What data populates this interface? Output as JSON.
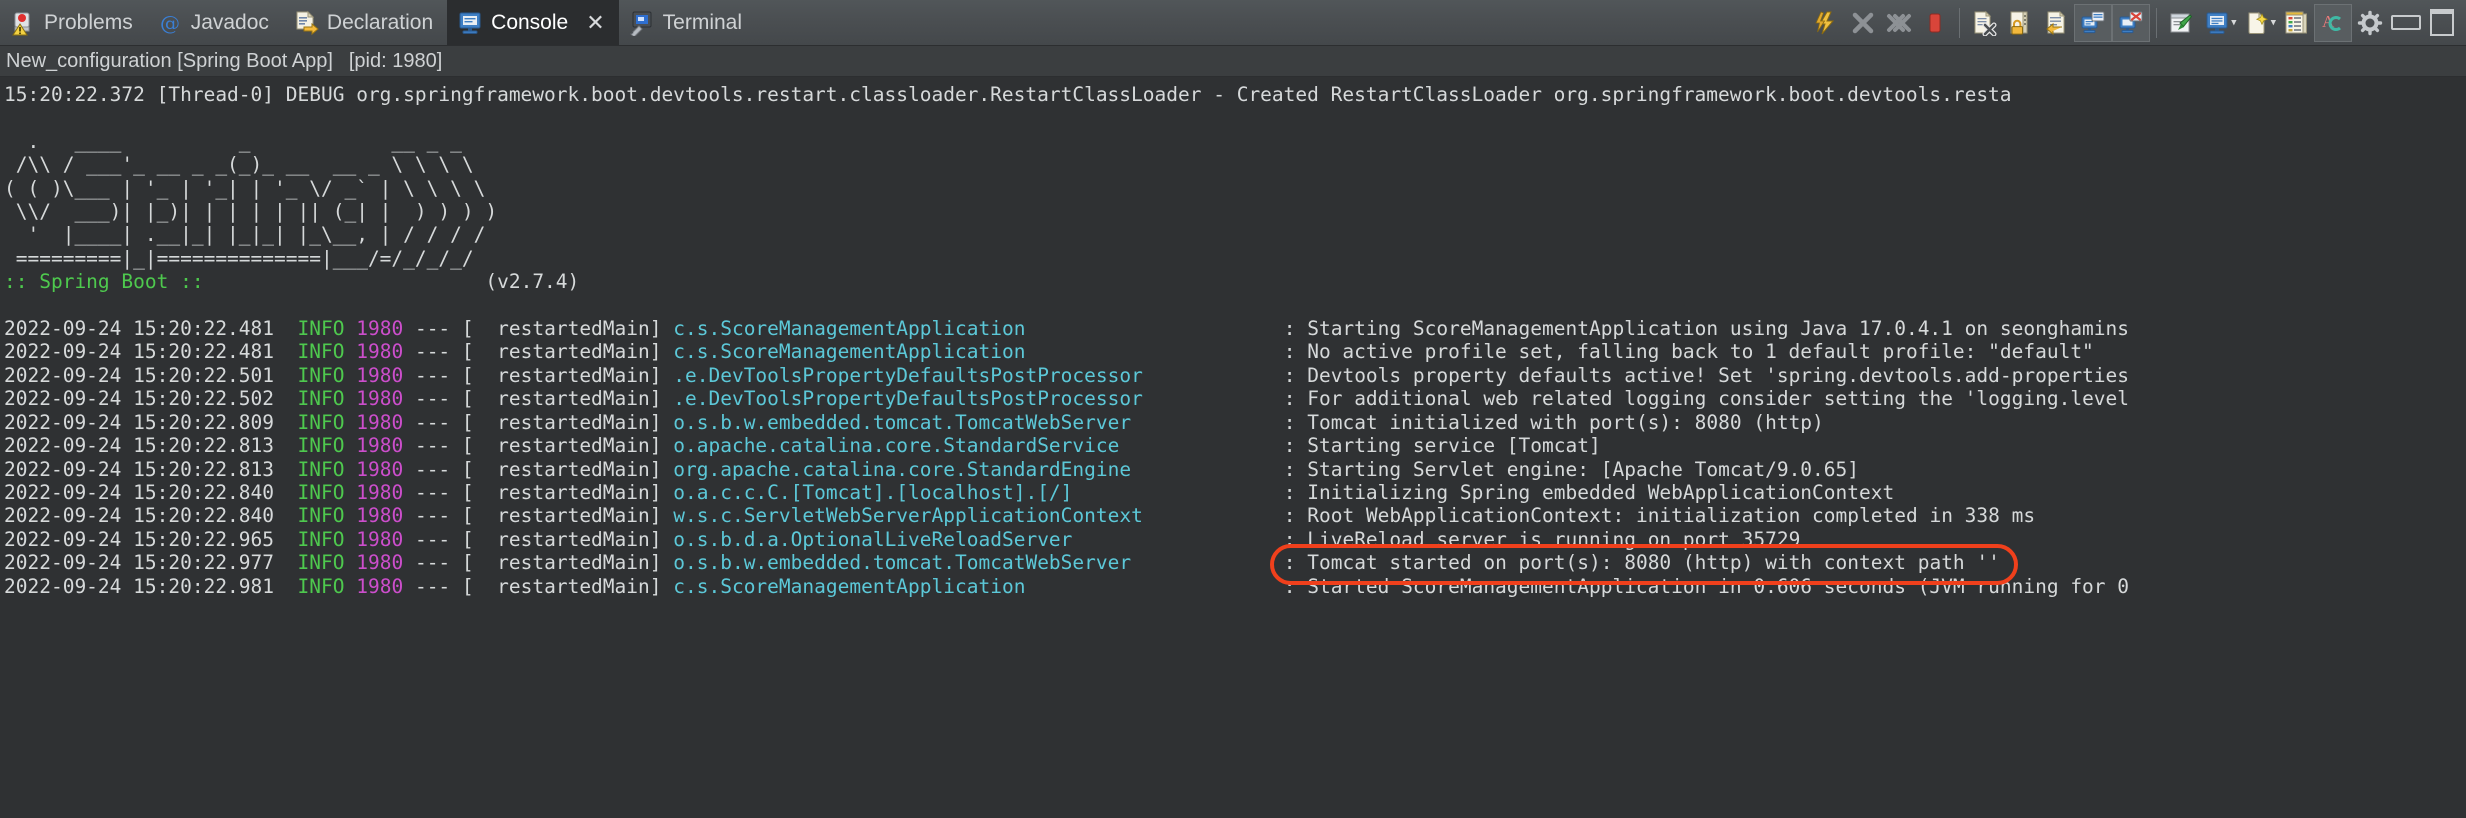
{
  "tabs": [
    {
      "label": "Problems",
      "icon": "problems-icon",
      "active": false,
      "closable": false
    },
    {
      "label": "Javadoc",
      "icon": "javadoc-icon",
      "active": false,
      "closable": false
    },
    {
      "label": "Declaration",
      "icon": "declaration-icon",
      "active": false,
      "closable": false
    },
    {
      "label": "Console",
      "icon": "console-icon",
      "active": true,
      "closable": true,
      "close_label": "✕"
    },
    {
      "label": "Terminal",
      "icon": "terminal-icon",
      "active": false,
      "closable": false
    }
  ],
  "toolbar": {
    "buttons": [
      {
        "name": "relaunch-icon",
        "title": "Relaunch"
      },
      {
        "name": "terminate-icon",
        "title": "Terminate"
      },
      {
        "name": "terminate-all-icon",
        "title": "Terminate All"
      },
      {
        "name": "stop-icon",
        "title": "Stop"
      },
      {
        "name": "clear-console-icon",
        "title": "Clear Console"
      },
      {
        "name": "scroll-lock-icon",
        "title": "Scroll Lock"
      },
      {
        "name": "word-wrap-icon",
        "title": "Word Wrap"
      },
      {
        "name": "show-console-icon",
        "title": "Show Console When Standard Out Changes"
      },
      {
        "name": "show-console-err-icon",
        "title": "Show Console When Standard Error Changes"
      },
      {
        "name": "pin-console-icon",
        "title": "Pin Console"
      },
      {
        "name": "display-selected-console-icon",
        "title": "Display Selected Console"
      },
      {
        "name": "open-console-icon",
        "title": "Open Console"
      },
      {
        "name": "console-preferences-icon",
        "title": "Console Preferences"
      },
      {
        "name": "ansi-color-icon",
        "title": "ANSI Console Color"
      },
      {
        "name": "view-menu-icon",
        "title": "View Menu"
      },
      {
        "name": "minimize-icon",
        "title": "Minimize"
      },
      {
        "name": "maximize-icon",
        "title": "Maximize"
      }
    ]
  },
  "config": {
    "name": "New_configuration [Spring Boot App]",
    "pid": "[pid: 1980]"
  },
  "console": {
    "debug_line": "15:20:22.372 [Thread-0] DEBUG org.springframework.boot.devtools.restart.classloader.RestartClassLoader - Created RestartClassLoader org.springframework.boot.devtools.resta",
    "banner": [
      "",
      "  .   ____          _            __ _ _",
      " /\\\\ / ___'_ __ _ _(_)_ __  __ _ \\ \\ \\ \\",
      "( ( )\\___ | '_ | '_| | '_ \\/ _` | \\ \\ \\ \\",
      " \\\\/  ___)| |_)| | | | | || (_| |  ) ) ) )",
      "  '  |____| .__|_| |_|_| |_\\__, | / / / /",
      " =========|_|==============|___/=/_/_/_/"
    ],
    "banner_label": ":: Spring Boot ::",
    "banner_version": "(v2.7.4)",
    "banner_label_pad": "                ",
    "banner_version_pad": "        ",
    "entries": [
      {
        "date": "2022-09-24 15:20:22.481",
        "level": "INFO",
        "pid": "1980",
        "sep": "---",
        "thread": "[  restartedMain]",
        "logger": "c.s.ScoreManagementApplication",
        "logger_pad": "                      ",
        "message": ": Starting ScoreManagementApplication using Java 17.0.4.1 on seonghamins",
        "highlight": false
      },
      {
        "date": "2022-09-24 15:20:22.481",
        "level": "INFO",
        "pid": "1980",
        "sep": "---",
        "thread": "[  restartedMain]",
        "logger": "c.s.ScoreManagementApplication",
        "logger_pad": "                      ",
        "message": ": No active profile set, falling back to 1 default profile: \"default\"",
        "highlight": false
      },
      {
        "date": "2022-09-24 15:20:22.501",
        "level": "INFO",
        "pid": "1980",
        "sep": "---",
        "thread": "[  restartedMain]",
        "logger": ".e.DevToolsPropertyDefaultsPostProcessor",
        "logger_pad": "            ",
        "message": ": Devtools property defaults active! Set 'spring.devtools.add-properties",
        "highlight": false
      },
      {
        "date": "2022-09-24 15:20:22.502",
        "level": "INFO",
        "pid": "1980",
        "sep": "---",
        "thread": "[  restartedMain]",
        "logger": ".e.DevToolsPropertyDefaultsPostProcessor",
        "logger_pad": "            ",
        "message": ": For additional web related logging consider setting the 'logging.level",
        "highlight": false
      },
      {
        "date": "2022-09-24 15:20:22.809",
        "level": "INFO",
        "pid": "1980",
        "sep": "---",
        "thread": "[  restartedMain]",
        "logger": "o.s.b.w.embedded.tomcat.TomcatWebServer",
        "logger_pad": "             ",
        "message": ": Tomcat initialized with port(s): 8080 (http)",
        "highlight": false
      },
      {
        "date": "2022-09-24 15:20:22.813",
        "level": "INFO",
        "pid": "1980",
        "sep": "---",
        "thread": "[  restartedMain]",
        "logger": "o.apache.catalina.core.StandardService",
        "logger_pad": "              ",
        "message": ": Starting service [Tomcat]",
        "highlight": false
      },
      {
        "date": "2022-09-24 15:20:22.813",
        "level": "INFO",
        "pid": "1980",
        "sep": "---",
        "thread": "[  restartedMain]",
        "logger": "org.apache.catalina.core.StandardEngine",
        "logger_pad": "             ",
        "message": ": Starting Servlet engine: [Apache Tomcat/9.0.65]",
        "highlight": false
      },
      {
        "date": "2022-09-24 15:20:22.840",
        "level": "INFO",
        "pid": "1980",
        "sep": "---",
        "thread": "[  restartedMain]",
        "logger": "o.a.c.c.C.[Tomcat].[localhost].[/]",
        "logger_pad": "                  ",
        "message": ": Initializing Spring embedded WebApplicationContext",
        "highlight": false
      },
      {
        "date": "2022-09-24 15:20:22.840",
        "level": "INFO",
        "pid": "1980",
        "sep": "---",
        "thread": "[  restartedMain]",
        "logger": "w.s.c.ServletWebServerApplicationContext",
        "logger_pad": "            ",
        "message": ": Root WebApplicationContext: initialization completed in 338 ms",
        "highlight": false
      },
      {
        "date": "2022-09-24 15:20:22.965",
        "level": "INFO",
        "pid": "1980",
        "sep": "---",
        "thread": "[  restartedMain]",
        "logger": "o.s.b.d.a.OptionalLiveReloadServer",
        "logger_pad": "                  ",
        "message": ": LiveReload server is running on port 35729",
        "highlight": false
      },
      {
        "date": "2022-09-24 15:20:22.977",
        "level": "INFO",
        "pid": "1980",
        "sep": "---",
        "thread": "[  restartedMain]",
        "logger": "o.s.b.w.embedded.tomcat.TomcatWebServer",
        "logger_pad": "             ",
        "message": ": Tomcat started on port(s): 8080 (http) with context path ''",
        "highlight": true
      },
      {
        "date": "2022-09-24 15:20:22.981",
        "level": "INFO",
        "pid": "1980",
        "sep": "---",
        "thread": "[  restartedMain]",
        "logger": "c.s.ScoreManagementApplication",
        "logger_pad": "                      ",
        "message": ": Started ScoreManagementApplication in 0.606 seconds (JVM running for 0",
        "highlight": false
      }
    ],
    "highlight_annotation": {
      "color": "#f0401c",
      "shape": "ellipse",
      "target_text": "Tomcat started on port(s): 8080 (http) with context path ''"
    }
  },
  "colors": {
    "background": "#2f3133",
    "tabbar": "#4a4e51",
    "active_tab": "#2b2d2f",
    "info_green": "#4ec94e",
    "pid_magenta": "#cc4ecc",
    "logger_cyan": "#5cc8d8",
    "text": "#d6d9da",
    "highlight_red": "#f0401c"
  }
}
